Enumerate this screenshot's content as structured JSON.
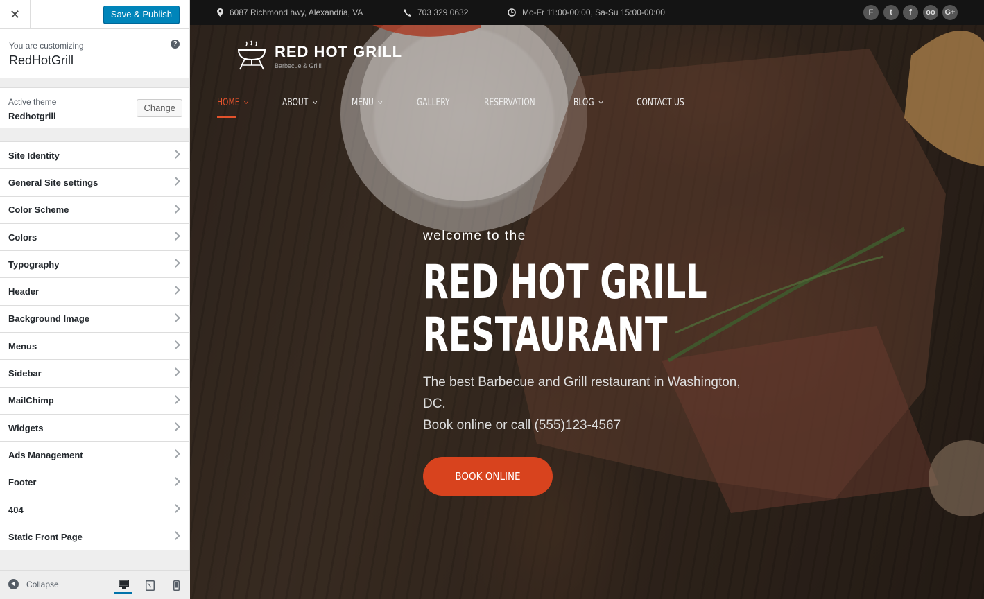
{
  "customizer": {
    "close_icon": "close-icon",
    "save_label": "Save & Publish",
    "customizing_label": "You are customizing",
    "site_name": "RedHotGrill",
    "help_icon": "?",
    "active_theme_label": "Active theme",
    "theme_name": "Redhotgrill",
    "change_label": "Change",
    "sections": [
      {
        "label": "Site Identity"
      },
      {
        "label": "General Site settings"
      },
      {
        "label": "Color Scheme"
      },
      {
        "label": "Colors"
      },
      {
        "label": "Typography"
      },
      {
        "label": "Header"
      },
      {
        "label": "Background Image"
      },
      {
        "label": "Menus"
      },
      {
        "label": "Sidebar"
      },
      {
        "label": "MailChimp"
      },
      {
        "label": "Widgets"
      },
      {
        "label": "Ads Management"
      },
      {
        "label": "Footer"
      },
      {
        "label": "404"
      },
      {
        "label": "Static Front Page"
      }
    ],
    "collapse_label": "Collapse",
    "devices": [
      "desktop-icon",
      "tablet-icon",
      "mobile-icon"
    ]
  },
  "preview": {
    "topbar": {
      "address": "6087 Richmond hwy, Alexandria, VA",
      "phone": "703 329 0632",
      "hours": "Mo-Fr 11:00-00:00, Sa-Su 15:00-00:00",
      "social": [
        "foursquare-icon",
        "twitter-icon",
        "facebook-icon",
        "tripadvisor-icon",
        "google-plus-icon"
      ]
    },
    "logo": {
      "name": "RED HOT GRILL",
      "tagline": "Barbecue & Grill!"
    },
    "nav": [
      {
        "label": "HOME",
        "dropdown": true,
        "active": true
      },
      {
        "label": "ABOUT",
        "dropdown": true
      },
      {
        "label": "MENU",
        "dropdown": true
      },
      {
        "label": "GALLERY",
        "dropdown": false
      },
      {
        "label": "RESERVATION",
        "dropdown": false
      },
      {
        "label": "BLOG",
        "dropdown": true
      },
      {
        "label": "CONTACT US",
        "dropdown": false
      }
    ],
    "hero": {
      "welcome": "welcome to the",
      "title_line1": "RED HOT GRILL",
      "title_line2": "RESTAURANT",
      "desc_line1": "The best Barbecue and Grill restaurant in Washington, DC.",
      "desc_line2": "Book online or call (555)123-4567",
      "button": "BOOK ONLINE"
    }
  },
  "colors": {
    "wp_primary": "#0085ba",
    "accent": "#d8431e",
    "nav_active": "#e2522c"
  }
}
